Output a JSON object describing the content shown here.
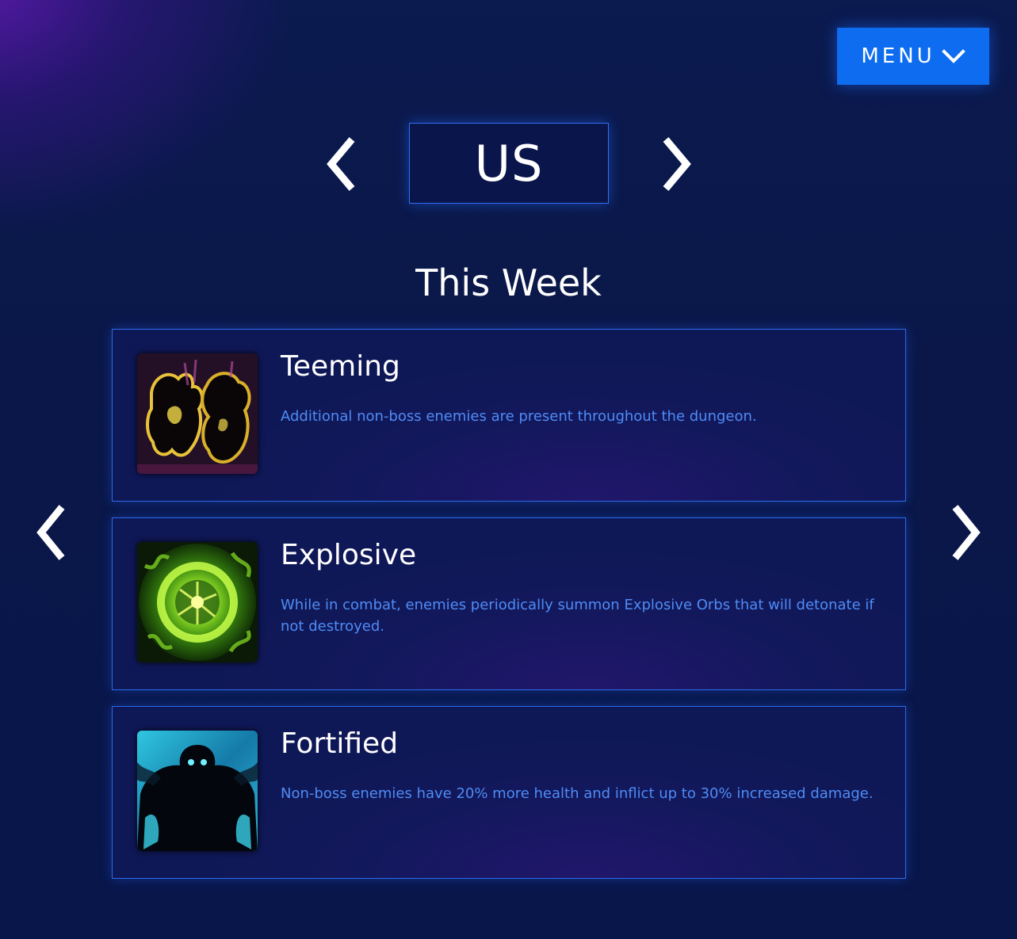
{
  "menu": {
    "label": "MENU",
    "chevron_icon": "chevron-down-icon"
  },
  "region": {
    "current": "US",
    "prev_icon": "chevron-left-icon",
    "next_icon": "chevron-right-icon"
  },
  "week": {
    "title": "This Week",
    "prev_icon": "chevron-left-icon",
    "next_icon": "chevron-right-icon"
  },
  "affixes": [
    {
      "name": "Teeming",
      "description": "Additional non-boss enemies are present throughout the dungeon.",
      "icon": "teeming-icon"
    },
    {
      "name": "Explosive",
      "description": "While in combat, enemies periodically summon Explosive Orbs that will detonate if not destroyed.",
      "icon": "explosive-icon"
    },
    {
      "name": "Fortified",
      "description": "Non-boss enemies have 20% more health and inflict up to 30% increased damage.",
      "icon": "fortified-icon"
    }
  ],
  "colors": {
    "accent": "#0d6cf0",
    "card_border": "#2b6ae8",
    "description_text": "#4f8cf5",
    "background": "#0a1748"
  }
}
